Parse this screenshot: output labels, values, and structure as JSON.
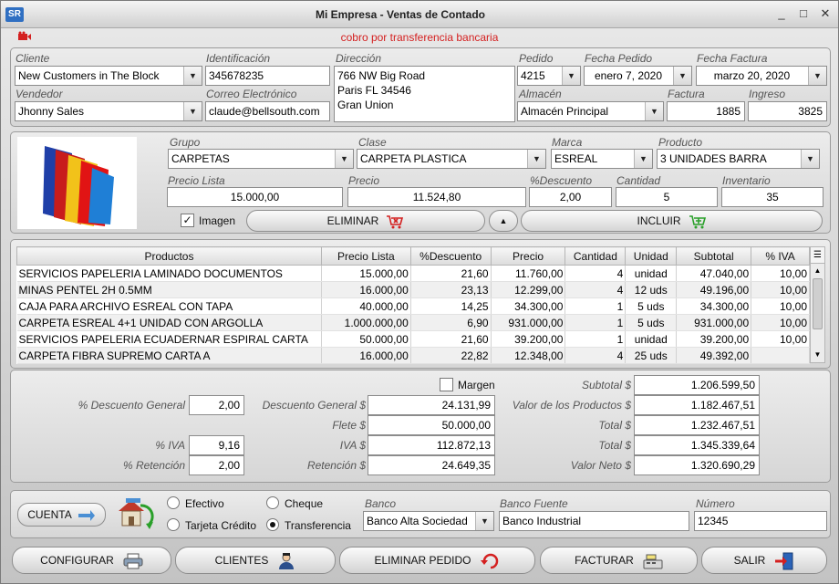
{
  "window": {
    "title": "Mi Empresa - Ventas de Contado",
    "logo": "SR",
    "minimize": "_",
    "restore": "□",
    "close": "✕"
  },
  "notice": "cobro por transferencia bancaria",
  "header": {
    "cliente_label": "Cliente",
    "cliente": "New Customers in The Block",
    "identificacion_label": "Identificación",
    "identificacion": "345678235",
    "direccion_label": "Dirección",
    "direccion_l1": "766 NW Big Road",
    "direccion_l2": "Paris FL 34546",
    "direccion_l3": "Gran Union",
    "pedido_label": "Pedido",
    "pedido": "4215",
    "fecha_pedido_label": "Fecha Pedido",
    "fecha_pedido": "enero 7, 2020",
    "fecha_factura_label": "Fecha Factura",
    "fecha_factura": "marzo 20, 2020",
    "vendedor_label": "Vendedor",
    "vendedor": "Jhonny Sales",
    "correo_label": "Correo Electrónico",
    "correo": "claude@bellsouth.com",
    "almacen_label": "Almacén",
    "almacen": "Almacén Principal",
    "factura_label": "Factura",
    "factura": "1885",
    "ingreso_label": "Ingreso",
    "ingreso": "3825"
  },
  "product": {
    "grupo_label": "Grupo",
    "grupo": "CARPETAS",
    "clase_label": "Clase",
    "clase": "CARPETA PLASTICA",
    "marca_label": "Marca",
    "marca": "ESREAL",
    "producto_label": "Producto",
    "producto": "3 UNIDADES BARRA",
    "precio_lista_label": "Precio Lista",
    "precio_lista": "15.000,00",
    "precio_label": "Precio",
    "precio": "11.524,80",
    "descuento_label": "%Descuento",
    "descuento": "2,00",
    "cantidad_label": "Cantidad",
    "cantidad": "5",
    "inventario_label": "Inventario",
    "inventario": "35",
    "imagen_label": "Imagen",
    "imagen_checked": "✓",
    "eliminar_label": "ELIMINAR",
    "incluir_label": "INCLUIR",
    "collapse_label": "▲"
  },
  "grid": {
    "columns": [
      "Productos",
      "Precio Lista",
      "%Descuento",
      "Precio",
      "Cantidad",
      "Unidad",
      "Subtotal",
      "% IVA"
    ],
    "rows": [
      [
        "SERVICIOS PAPELERIA LAMINADO DOCUMENTOS",
        "15.000,00",
        "21,60",
        "11.760,00",
        "4",
        "unidad",
        "47.040,00",
        "10,00"
      ],
      [
        "MINAS PENTEL 2H 0.5MM",
        "16.000,00",
        "23,13",
        "12.299,00",
        "4",
        "12 uds",
        "49.196,00",
        "10,00"
      ],
      [
        "CAJA PARA ARCHIVO ESREAL CON TAPA",
        "40.000,00",
        "14,25",
        "34.300,00",
        "1",
        "5 uds",
        "34.300,00",
        "10,00"
      ],
      [
        "CARPETA ESREAL 4+1 UNIDAD CON ARGOLLA",
        "1.000.000,00",
        "6,90",
        "931.000,00",
        "1",
        "5 uds",
        "931.000,00",
        "10,00"
      ],
      [
        "SERVICIOS PAPELERIA ECUADERNAR ESPIRAL CARTA",
        "50.000,00",
        "21,60",
        "39.200,00",
        "1",
        "unidad",
        "39.200,00",
        "10,00"
      ],
      [
        "CARPETA FIBRA SUPREMO CARTA A",
        "16.000,00",
        "22,82",
        "12.348,00",
        "4",
        "25 uds",
        "49.392,00",
        ""
      ]
    ]
  },
  "totals": {
    "margen_label": "Margen",
    "desc_general_label": "% Descuento General",
    "desc_general": "2,00",
    "iva_pct_label": "% IVA",
    "iva_pct": "9,16",
    "retencion_pct_label": "% Retención",
    "retencion_pct": "2,00",
    "descuento_general_label": "Descuento General $",
    "descuento_general": "24.131,99",
    "flete_label": "Flete $",
    "flete": "50.000,00",
    "iva_label": "IVA $",
    "iva": "112.872,13",
    "retencion_label": "Retención $",
    "retencion": "24.649,35",
    "subtotal_label": "Subtotal $",
    "subtotal": "1.206.599,50",
    "valor_productos_label": "Valor de los Productos $",
    "valor_productos": "1.182.467,51",
    "total1_label": "Total $",
    "total1": "1.232.467,51",
    "total2_label": "Total $",
    "total2": "1.345.339,64",
    "valor_neto_label": "Valor Neto $",
    "valor_neto": "1.320.690,29"
  },
  "payment": {
    "cuenta_label": "CUENTA",
    "efectivo_label": "Efectivo",
    "cheque_label": "Cheque",
    "tarjeta_label": "Tarjeta Crédito",
    "transferencia_label": "Transferencia",
    "banco_label": "Banco",
    "banco": "Banco Alta Sociedad",
    "banco_fuente_label": "Banco Fuente",
    "banco_fuente": "Banco Industrial",
    "numero_label": "Número",
    "numero": "12345"
  },
  "actions": {
    "configurar": "CONFIGURAR",
    "clientes": "CLIENTES",
    "eliminar_pedido": "ELIMINAR PEDIDO",
    "facturar": "FACTURAR",
    "salir": "SALIR"
  },
  "colors": {
    "notice": "#d42020",
    "incluir": "#2aa02a",
    "eliminar": "#d42020"
  }
}
